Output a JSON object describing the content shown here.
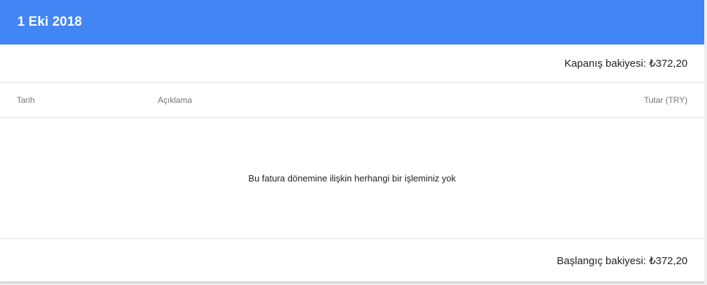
{
  "statement": {
    "period_title": "1 Eki 2018",
    "closing_balance_label": "Kapanış bakiyesi: ₺372,20",
    "columns": {
      "date": "Tarih",
      "description": "Açıklama",
      "amount": "Tutar (TRY)"
    },
    "empty_message": "Bu fatura dönemine ilişkin herhangi bir işleminiz yok",
    "opening_balance_label": "Başlangıç bakiyesi: ₺372,20"
  },
  "colors": {
    "header_bg": "#4285f4",
    "header_text": "#ffffff",
    "divider": "#e0e0e0"
  }
}
